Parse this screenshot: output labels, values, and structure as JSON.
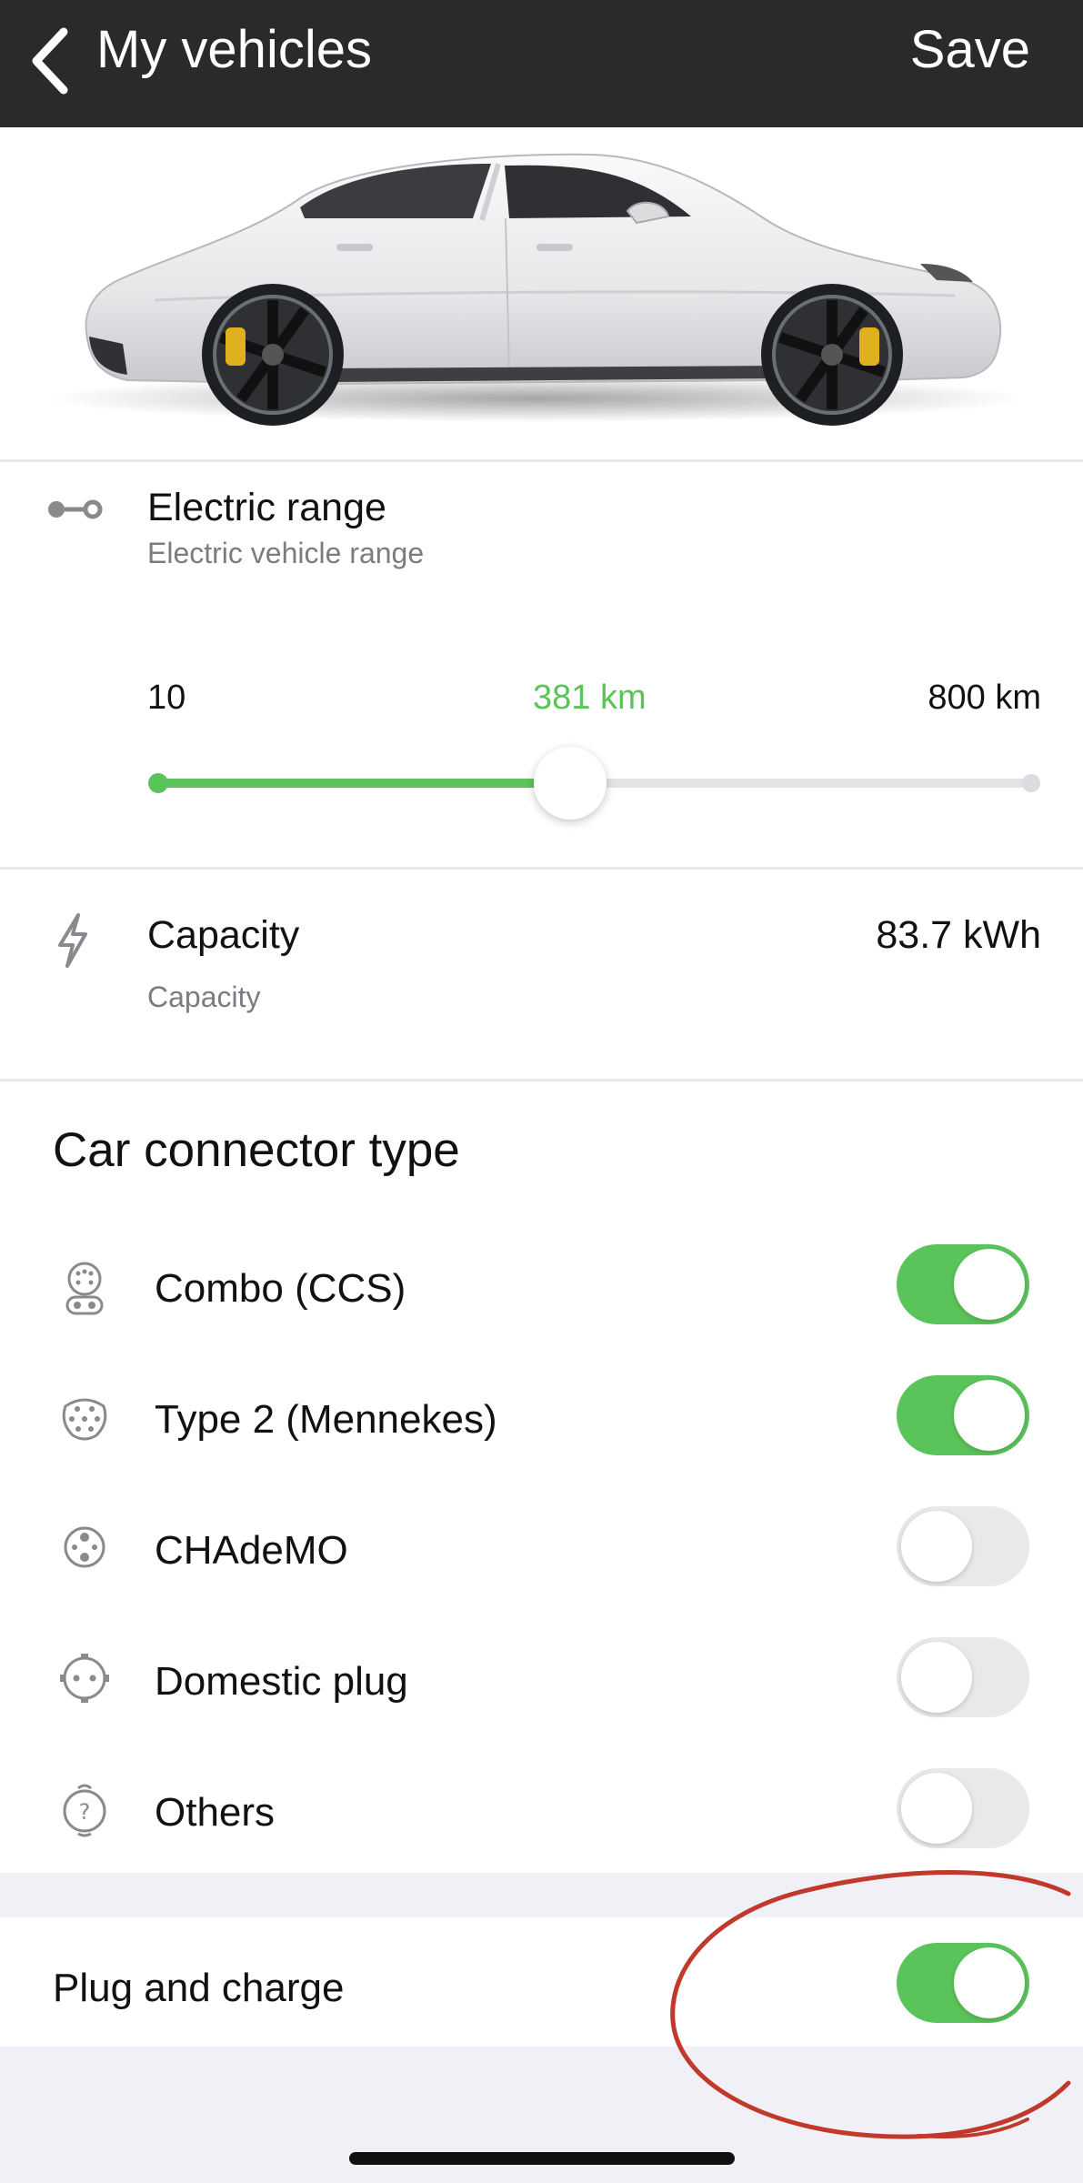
{
  "header": {
    "title": "My vehicles",
    "save_label": "Save"
  },
  "electric_range": {
    "title": "Electric range",
    "subtitle": "Electric vehicle range",
    "min_label": "10",
    "current_label": "381 km",
    "max_label": "800 km",
    "slider": {
      "min": 10,
      "max": 800,
      "value": 381,
      "unit": "km"
    }
  },
  "capacity": {
    "title": "Capacity",
    "subtitle": "Capacity",
    "value": "83.7 kWh"
  },
  "connectors": {
    "heading": "Car connector type",
    "items": [
      {
        "label": "Combo (CCS)",
        "icon": "ccs-connector-icon",
        "enabled": true
      },
      {
        "label": "Type 2 (Mennekes)",
        "icon": "type2-connector-icon",
        "enabled": true
      },
      {
        "label": "CHAdeMO",
        "icon": "chademo-connector-icon",
        "enabled": false
      },
      {
        "label": "Domestic plug",
        "icon": "domestic-plug-icon",
        "enabled": false
      },
      {
        "label": "Others",
        "icon": "question-connector-icon",
        "enabled": false
      }
    ]
  },
  "plug_and_charge": {
    "label": "Plug and charge",
    "enabled": true
  },
  "colors": {
    "header_bg": "#2a2a2c",
    "accent_green": "#5ac45a",
    "annotation_red": "#c0392b",
    "page_bg": "#f1f0f6"
  }
}
